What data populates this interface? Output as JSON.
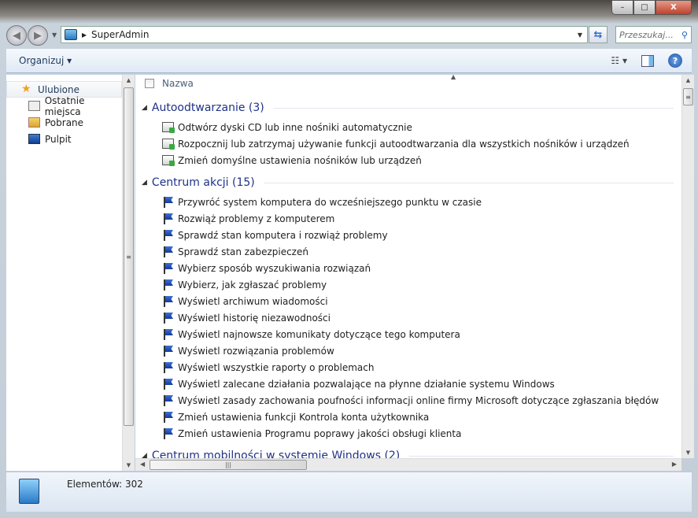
{
  "window": {
    "buttons": {
      "minimize": "–",
      "maximize": "□",
      "close": "X"
    }
  },
  "address": {
    "path": "SuperAdmin",
    "separator": "▸"
  },
  "search": {
    "placeholder": "Przeszukaj..."
  },
  "toolbar": {
    "organize": "Organizuj ▾",
    "views": "☷ ▾",
    "help": "?"
  },
  "sidebar": {
    "items": [
      {
        "label": "Ulubione",
        "icon": "star-icon"
      },
      {
        "label": "Ostatnie miejsca",
        "icon": "recent-places-icon"
      },
      {
        "label": "Pobrane",
        "icon": "downloads-icon"
      },
      {
        "label": "Pulpit",
        "icon": "desktop-icon"
      }
    ]
  },
  "main": {
    "column_header": "Nazwa",
    "groups": [
      {
        "title": "Autoodtwarzanie (3)",
        "items": [
          "Odtwórz dyski CD lub inne nośniki automatycznie",
          "Rozpocznij lub zatrzymaj używanie funkcji autoodtwarzania dla wszystkich nośników i urządzeń",
          "Zmień domyślne ustawienia nośników lub urządzeń"
        ]
      },
      {
        "title": "Centrum akcji (15)",
        "items": [
          "Przywróć system komputera do wcześniejszego punktu w czasie",
          "Rozwiąż problemy z komputerem",
          "Sprawdź stan komputera i rozwiąż problemy",
          "Sprawdź stan zabezpieczeń",
          "Wybierz sposób wyszukiwania rozwiązań",
          "Wybierz, jak zgłaszać problemy",
          "Wyświetl archiwum wiadomości",
          "Wyświetl historię niezawodności",
          "Wyświetl najnowsze komunikaty dotyczące tego komputera",
          "Wyświetl rozwiązania problemów",
          "Wyświetl wszystkie raporty o problemach",
          "Wyświetl zalecane działania pozwalające na płynne działanie systemu Windows",
          "Wyświetl zasady zachowania poufności informacji online firmy Microsoft dotyczące zgłaszania błędów",
          "Zmień ustawienia funkcji Kontrola konta użytkownika",
          "Zmień ustawienia Programu poprawy jakości obsługi klienta"
        ]
      },
      {
        "title": "Centrum mobilności w systemie Windows (2)",
        "items": []
      }
    ]
  },
  "status": {
    "text": "Elementów: 302"
  }
}
